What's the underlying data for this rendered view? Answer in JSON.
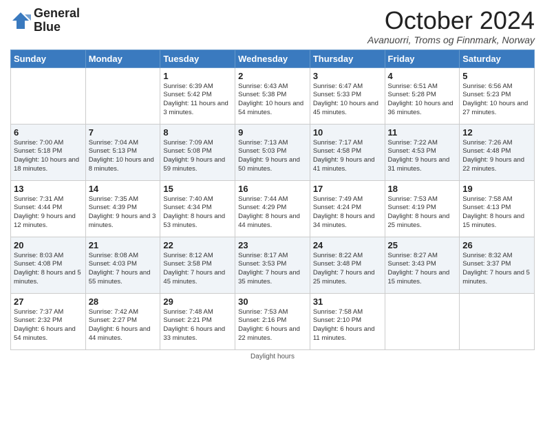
{
  "logo": {
    "line1": "General",
    "line2": "Blue"
  },
  "title": "October 2024",
  "subtitle": "Avanuorri, Troms og Finnmark, Norway",
  "footer": "Daylight hours",
  "weekdays": [
    "Sunday",
    "Monday",
    "Tuesday",
    "Wednesday",
    "Thursday",
    "Friday",
    "Saturday"
  ],
  "weeks": [
    [
      {
        "day": "",
        "info": ""
      },
      {
        "day": "",
        "info": ""
      },
      {
        "day": "1",
        "info": "Sunrise: 6:39 AM\nSunset: 5:42 PM\nDaylight: 11 hours\nand 3 minutes."
      },
      {
        "day": "2",
        "info": "Sunrise: 6:43 AM\nSunset: 5:38 PM\nDaylight: 10 hours\nand 54 minutes."
      },
      {
        "day": "3",
        "info": "Sunrise: 6:47 AM\nSunset: 5:33 PM\nDaylight: 10 hours\nand 45 minutes."
      },
      {
        "day": "4",
        "info": "Sunrise: 6:51 AM\nSunset: 5:28 PM\nDaylight: 10 hours\nand 36 minutes."
      },
      {
        "day": "5",
        "info": "Sunrise: 6:56 AM\nSunset: 5:23 PM\nDaylight: 10 hours\nand 27 minutes."
      }
    ],
    [
      {
        "day": "6",
        "info": "Sunrise: 7:00 AM\nSunset: 5:18 PM\nDaylight: 10 hours\nand 18 minutes."
      },
      {
        "day": "7",
        "info": "Sunrise: 7:04 AM\nSunset: 5:13 PM\nDaylight: 10 hours\nand 8 minutes."
      },
      {
        "day": "8",
        "info": "Sunrise: 7:09 AM\nSunset: 5:08 PM\nDaylight: 9 hours\nand 59 minutes."
      },
      {
        "day": "9",
        "info": "Sunrise: 7:13 AM\nSunset: 5:03 PM\nDaylight: 9 hours\nand 50 minutes."
      },
      {
        "day": "10",
        "info": "Sunrise: 7:17 AM\nSunset: 4:58 PM\nDaylight: 9 hours\nand 41 minutes."
      },
      {
        "day": "11",
        "info": "Sunrise: 7:22 AM\nSunset: 4:53 PM\nDaylight: 9 hours\nand 31 minutes."
      },
      {
        "day": "12",
        "info": "Sunrise: 7:26 AM\nSunset: 4:48 PM\nDaylight: 9 hours\nand 22 minutes."
      }
    ],
    [
      {
        "day": "13",
        "info": "Sunrise: 7:31 AM\nSunset: 4:44 PM\nDaylight: 9 hours\nand 12 minutes."
      },
      {
        "day": "14",
        "info": "Sunrise: 7:35 AM\nSunset: 4:39 PM\nDaylight: 9 hours\nand 3 minutes."
      },
      {
        "day": "15",
        "info": "Sunrise: 7:40 AM\nSunset: 4:34 PM\nDaylight: 8 hours\nand 53 minutes."
      },
      {
        "day": "16",
        "info": "Sunrise: 7:44 AM\nSunset: 4:29 PM\nDaylight: 8 hours\nand 44 minutes."
      },
      {
        "day": "17",
        "info": "Sunrise: 7:49 AM\nSunset: 4:24 PM\nDaylight: 8 hours\nand 34 minutes."
      },
      {
        "day": "18",
        "info": "Sunrise: 7:53 AM\nSunset: 4:19 PM\nDaylight: 8 hours\nand 25 minutes."
      },
      {
        "day": "19",
        "info": "Sunrise: 7:58 AM\nSunset: 4:13 PM\nDaylight: 8 hours\nand 15 minutes."
      }
    ],
    [
      {
        "day": "20",
        "info": "Sunrise: 8:03 AM\nSunset: 4:08 PM\nDaylight: 8 hours\nand 5 minutes."
      },
      {
        "day": "21",
        "info": "Sunrise: 8:08 AM\nSunset: 4:03 PM\nDaylight: 7 hours\nand 55 minutes."
      },
      {
        "day": "22",
        "info": "Sunrise: 8:12 AM\nSunset: 3:58 PM\nDaylight: 7 hours\nand 45 minutes."
      },
      {
        "day": "23",
        "info": "Sunrise: 8:17 AM\nSunset: 3:53 PM\nDaylight: 7 hours\nand 35 minutes."
      },
      {
        "day": "24",
        "info": "Sunrise: 8:22 AM\nSunset: 3:48 PM\nDaylight: 7 hours\nand 25 minutes."
      },
      {
        "day": "25",
        "info": "Sunrise: 8:27 AM\nSunset: 3:43 PM\nDaylight: 7 hours\nand 15 minutes."
      },
      {
        "day": "26",
        "info": "Sunrise: 8:32 AM\nSunset: 3:37 PM\nDaylight: 7 hours\nand 5 minutes."
      }
    ],
    [
      {
        "day": "27",
        "info": "Sunrise: 7:37 AM\nSunset: 2:32 PM\nDaylight: 6 hours\nand 54 minutes."
      },
      {
        "day": "28",
        "info": "Sunrise: 7:42 AM\nSunset: 2:27 PM\nDaylight: 6 hours\nand 44 minutes."
      },
      {
        "day": "29",
        "info": "Sunrise: 7:48 AM\nSunset: 2:21 PM\nDaylight: 6 hours\nand 33 minutes."
      },
      {
        "day": "30",
        "info": "Sunrise: 7:53 AM\nSunset: 2:16 PM\nDaylight: 6 hours\nand 22 minutes."
      },
      {
        "day": "31",
        "info": "Sunrise: 7:58 AM\nSunset: 2:10 PM\nDaylight: 6 hours\nand 11 minutes."
      },
      {
        "day": "",
        "info": ""
      },
      {
        "day": "",
        "info": ""
      }
    ]
  ]
}
